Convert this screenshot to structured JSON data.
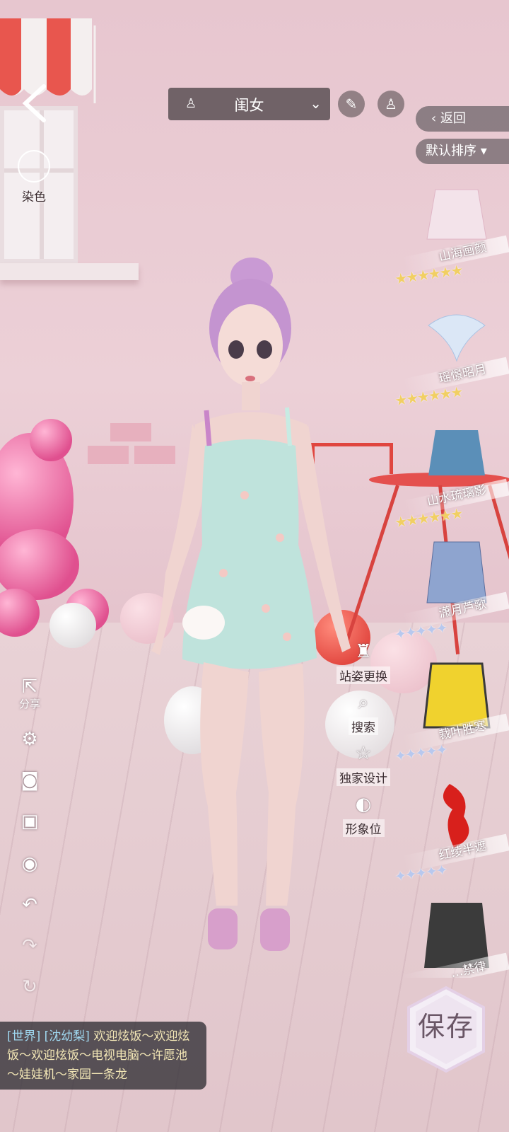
{
  "header": {
    "category": "闺女",
    "back_label": "返回",
    "sort_label": "默认排序",
    "dye_label": "染色"
  },
  "icons": {
    "category_icon": "dress-icon",
    "category_dropdown": "chevron-down-icon",
    "brush_button": "brush-icon",
    "dress_button": "dress-icon"
  },
  "clothing_items": [
    {
      "name": "山海画颜",
      "stars": 6,
      "rarity": "gold"
    },
    {
      "name": "瑶憬昭月",
      "stars": 6,
      "rarity": "gold"
    },
    {
      "name": "山水琉璃影",
      "stars": 6,
      "rarity": "gold"
    },
    {
      "name": "潇月芦歌",
      "stars": 5,
      "rarity": "silver"
    },
    {
      "name": "裁叶胜寒",
      "stars": 5,
      "rarity": "silver"
    },
    {
      "name": "红绫半遮",
      "stars": 5,
      "rarity": "silver"
    },
    {
      "name": "…禁律",
      "stars": 0,
      "rarity": "silver"
    }
  ],
  "side_actions": [
    {
      "label": "站姿更换",
      "icon": "person-icon"
    },
    {
      "label": "搜索",
      "icon": "search-icon"
    },
    {
      "label": "独家设计",
      "icon": "star-icon"
    },
    {
      "label": "形象位",
      "icon": "portrait-icon"
    }
  ],
  "left_tools": {
    "share_label": "分享"
  },
  "chat": {
    "channel": "[世界]",
    "user": "[沈幼梨]",
    "message": "欢迎炫饭～欢迎炫饭～欢迎炫饭～电视电脑～许愿池～娃娃机～家园一条龙"
  },
  "save_label": "保存",
  "colors": {
    "panel_bg": "#5a5055",
    "star_gold": "#f1cf63",
    "star_silver": "#b8c8ee",
    "chat_name": "#9fd7ef",
    "chat_msg": "#f3e7b6"
  }
}
